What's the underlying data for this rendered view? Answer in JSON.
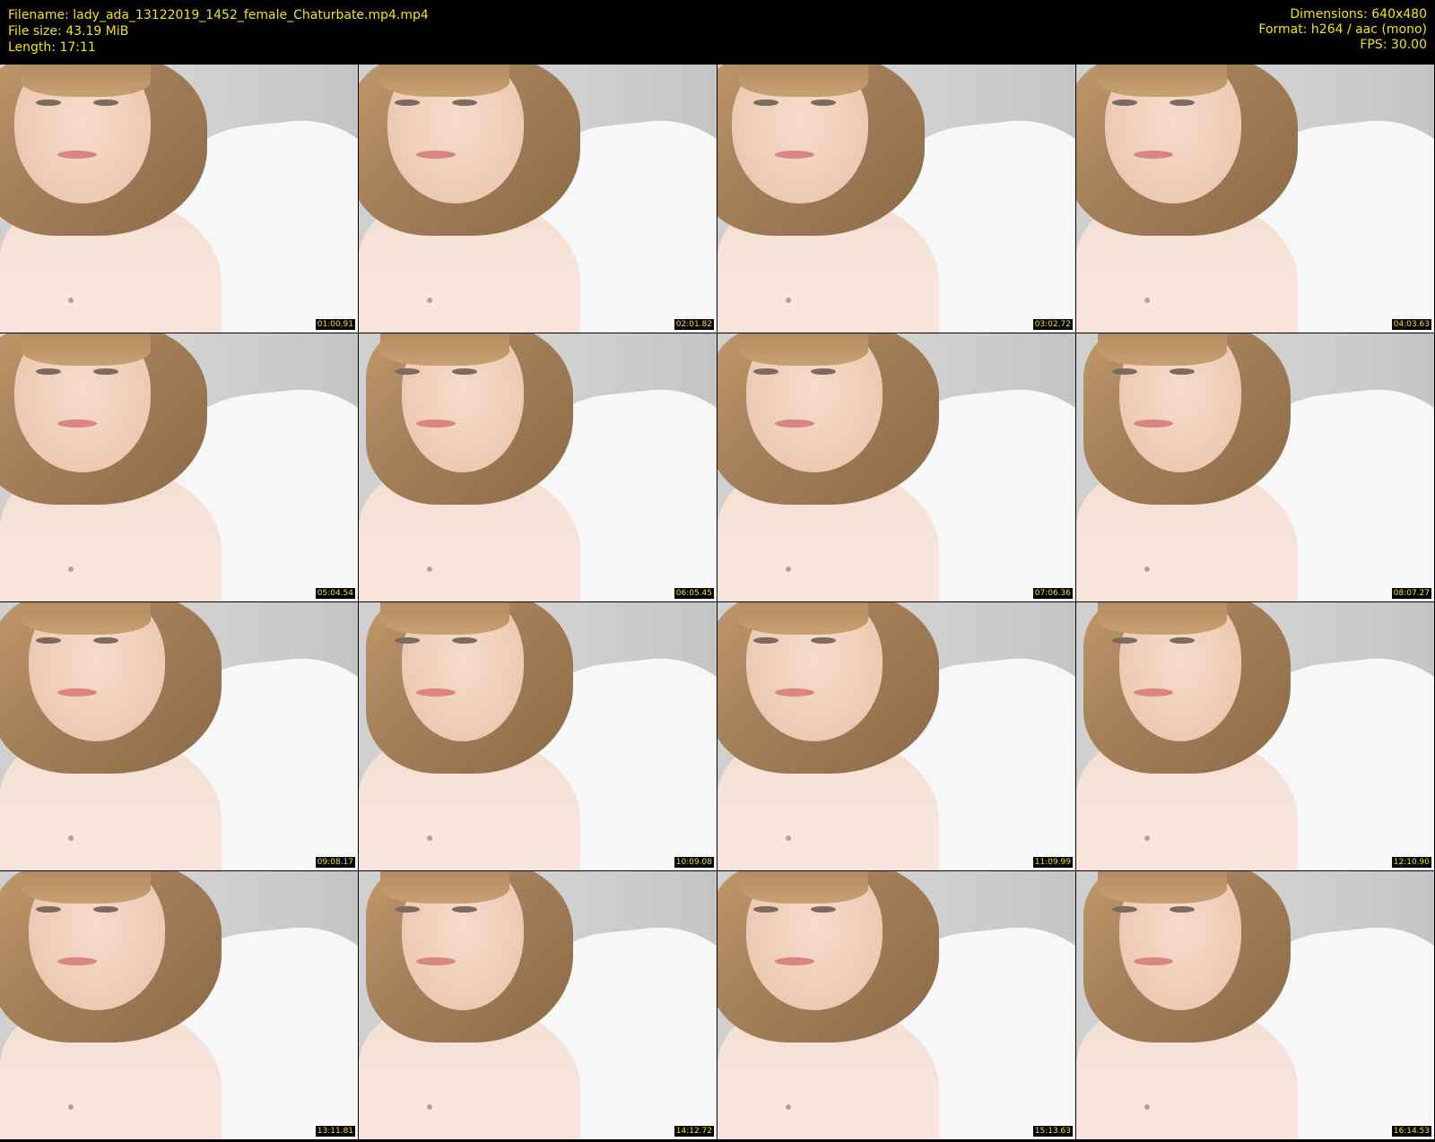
{
  "header": {
    "filename": "Filename: lady_ada_13122019_1452_female_Chaturbate.mp4.mp4",
    "filesize": "File size: 43.19 MiB",
    "length": "Length: 17:11",
    "dimensions": "Dimensions: 640x480",
    "format": "Format: h264 / aac (mono)",
    "fps": "FPS: 30.00"
  },
  "thumbnails": [
    {
      "timestamp": "01:00.91"
    },
    {
      "timestamp": "02:01.82"
    },
    {
      "timestamp": "03:02.72"
    },
    {
      "timestamp": "04:03.63"
    },
    {
      "timestamp": "05:04.54"
    },
    {
      "timestamp": "06:05.45"
    },
    {
      "timestamp": "07:06.36"
    },
    {
      "timestamp": "08:07.27"
    },
    {
      "timestamp": "09:08.17"
    },
    {
      "timestamp": "10:09.08"
    },
    {
      "timestamp": "11:09.99"
    },
    {
      "timestamp": "12:10.90"
    },
    {
      "timestamp": "13:11.81"
    },
    {
      "timestamp": "14:12.72"
    },
    {
      "timestamp": "15:13.63"
    },
    {
      "timestamp": "16:14.53"
    }
  ],
  "colors": {
    "background": "#000000",
    "text": "#f2e31a"
  }
}
